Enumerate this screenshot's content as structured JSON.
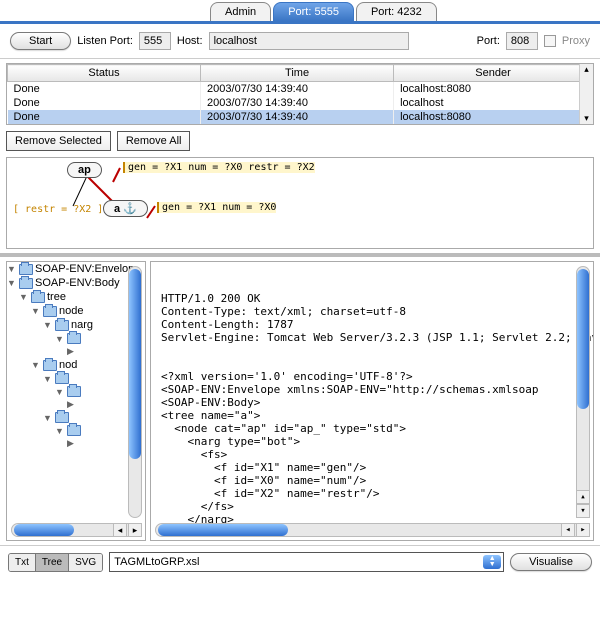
{
  "tabs": {
    "admin": "Admin",
    "port5555": "Port: 5555",
    "port4232": "Port: 4232"
  },
  "toolbar": {
    "start": "Start",
    "listen_label": "Listen Port:",
    "listen_value": "555",
    "host_label": "Host:",
    "host_value": "localhost",
    "port_label": "Port:",
    "port_value": "808",
    "proxy_label": "Proxy"
  },
  "table": {
    "headers": {
      "status": "Status",
      "time": "Time",
      "sender": "Sender"
    },
    "rows": [
      {
        "status": "Done",
        "time": "2003/07/30 14:39:40",
        "sender": "localhost:8080"
      },
      {
        "status": "Done",
        "time": "2003/07/30 14:39:40",
        "sender": "localhost"
      },
      {
        "status": "Done",
        "time": "2003/07/30 14:39:40",
        "sender": "localhost:8080"
      }
    ]
  },
  "buttons": {
    "remove_selected": "Remove Selected",
    "remove_all": "Remove All"
  },
  "graph": {
    "node_ap": "ap",
    "node_a": "a ",
    "fs_ap": "gen   =   ?X1\nnum   =   ?X0\nrestr =   ?X2",
    "fs_a": "gen   =   ?X1\nnum   =   ?X0",
    "restr_left": "[ restr  =   ?X2 ]"
  },
  "tree": {
    "n0": "SOAP-ENV:Envelop",
    "n1": "SOAP-ENV:Body",
    "n2": "tree",
    "n3": "node",
    "n4": "narg",
    "n5": "",
    "n6": "nod",
    "n7": "",
    "n8": "",
    "n9": ""
  },
  "output": "HTTP/1.0 200 OK\nContent-Type: text/xml; charset=utf-8\nContent-Length: 1787\nServlet-Engine: Tomcat Web Server/3.2.3 (JSP 1.1; Servlet 2.2; Java\n\n\n<?xml version='1.0' encoding='UTF-8'?>\n<SOAP-ENV:Envelope xmlns:SOAP-ENV=\"http://schemas.xmlsoap\n<SOAP-ENV:Body>\n<tree name=\"a\">\n  <node cat=\"ap\" id=\"ap_\" type=\"std\">\n    <narg type=\"bot\">\n      <fs>\n        <f id=\"X1\" name=\"gen\"/>\n        <f id=\"X0\" name=\"num\"/>\n        <f id=\"X2\" name=\"restr\"/>\n      </fs>\n    </narg>",
  "bottombar": {
    "seg_txt": "Txt",
    "seg_tree": "Tree",
    "seg_svg": "SVG",
    "stylesheet": "TAGMLtoGRP.xsl",
    "visualise": "Visualise"
  }
}
